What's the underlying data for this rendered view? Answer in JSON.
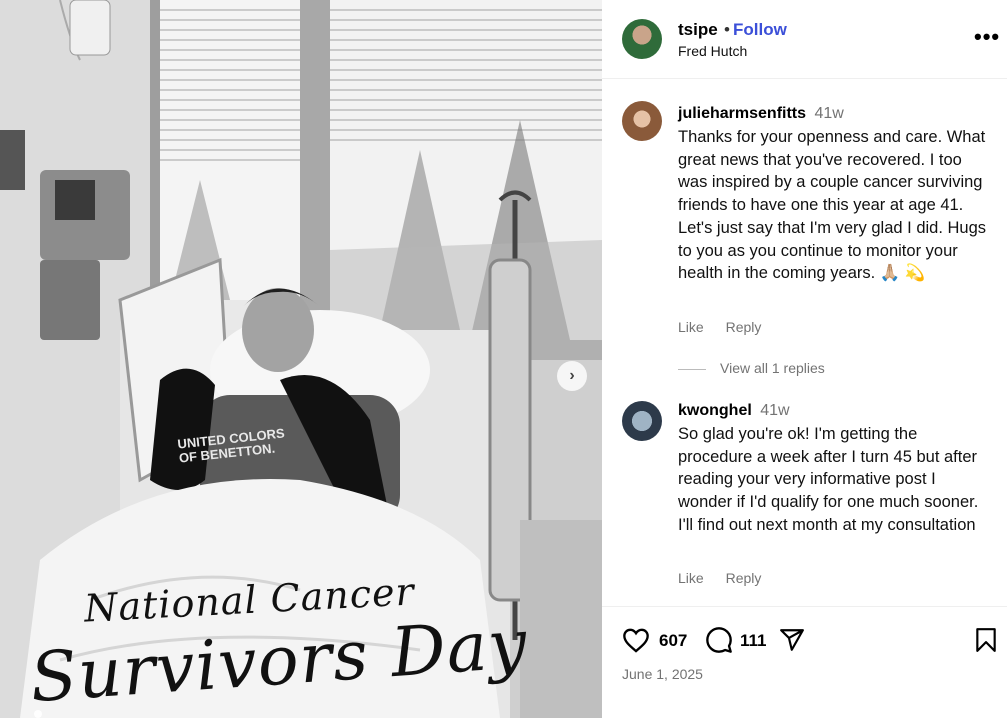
{
  "post": {
    "username": "tsipe",
    "separator": "•",
    "follow_label": "Follow",
    "location": "Fred Hutch",
    "more_label": "•••",
    "overlay_line1": "National Cancer",
    "overlay_line2": "Survivors Day",
    "shirt_line1": "UNITED COLORS",
    "shirt_line2": "OF BENETTON.",
    "next_label": "›",
    "likes": "607",
    "comments_count": "111",
    "date": "June 1, 2025"
  },
  "comments": [
    {
      "username": "julieharmsenfitts",
      "time": "41w",
      "text": "Thanks for your openness and care. What great news that you've recovered. I too was inspired by a couple cancer surviving friends to have one this year at age 41. Let's just say that I'm very glad I did. Hugs to you as you continue to monitor your health in the coming years. 🙏🏼 💫",
      "like_label": "Like",
      "reply_label": "Reply"
    },
    {
      "username": "kwonghel",
      "time": "41w",
      "text": "So glad you're ok! I'm getting the procedure a week after I turn 45 but after reading your very informative post I wonder if I'd qualify for one much sooner. I'll find out next month at my consultation",
      "like_label": "Like",
      "reply_label": "Reply"
    }
  ],
  "view_replies_label": "View all 1 replies",
  "icons": [
    "heart-icon",
    "comment-icon",
    "share-icon",
    "bookmark-icon",
    "more-icon",
    "chevron-right-icon"
  ]
}
